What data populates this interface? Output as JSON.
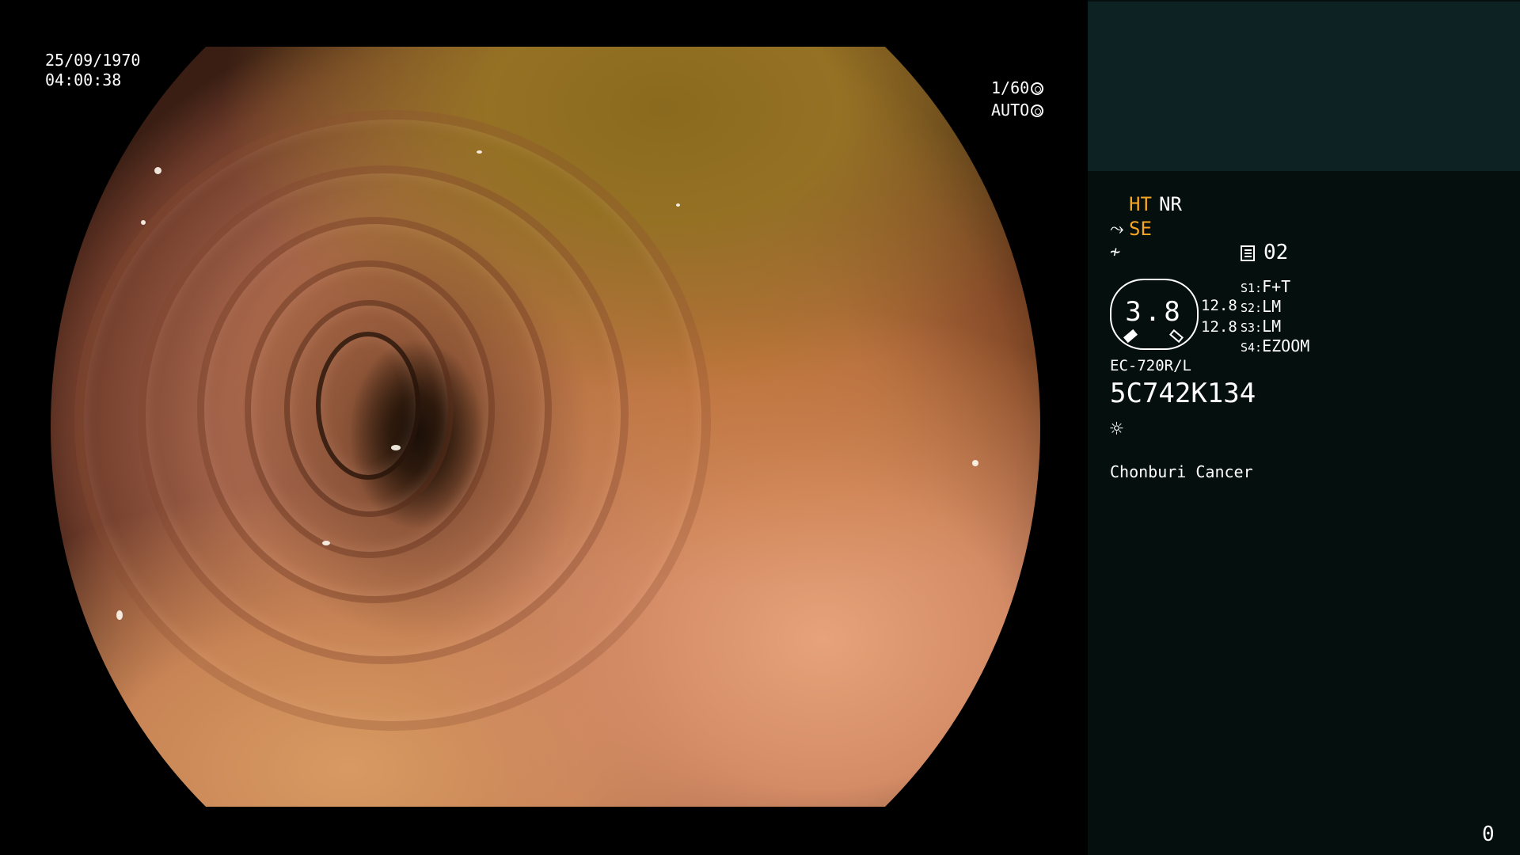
{
  "overlay": {
    "date": "25/09/1970",
    "time": "04:00:38",
    "shutter": "1/60",
    "iris": "AUTO",
    "shutter_icon": "shutter-icon",
    "iris_icon": "iris-icon"
  },
  "panel": {
    "ht": "HT",
    "nr": "NR",
    "se": "SE",
    "se_icon": "structure-enhance-icon",
    "enhance_icon": "enhance-off-icon",
    "page_icon": "memory-page-icon",
    "page_no": "02",
    "zoom": {
      "value": "3.8",
      "right_top": "12.8",
      "right_bottom": "12.8"
    },
    "switches": [
      {
        "label": "S1:",
        "value": "F+T"
      },
      {
        "label": "S2:",
        "value": "LM"
      },
      {
        "label": "S3:",
        "value": "LM"
      },
      {
        "label": "S4:",
        "value": "EZOOM"
      }
    ],
    "model": "EC-720R/L",
    "serial": "5C742K134",
    "light_icon": "light-source-icon",
    "hospital": "Chonburi Cancer",
    "counter": "0"
  },
  "colors": {
    "accent_orange": "#f6a623",
    "panel_top": "#0c2223",
    "panel_bg": "#040f0e"
  }
}
